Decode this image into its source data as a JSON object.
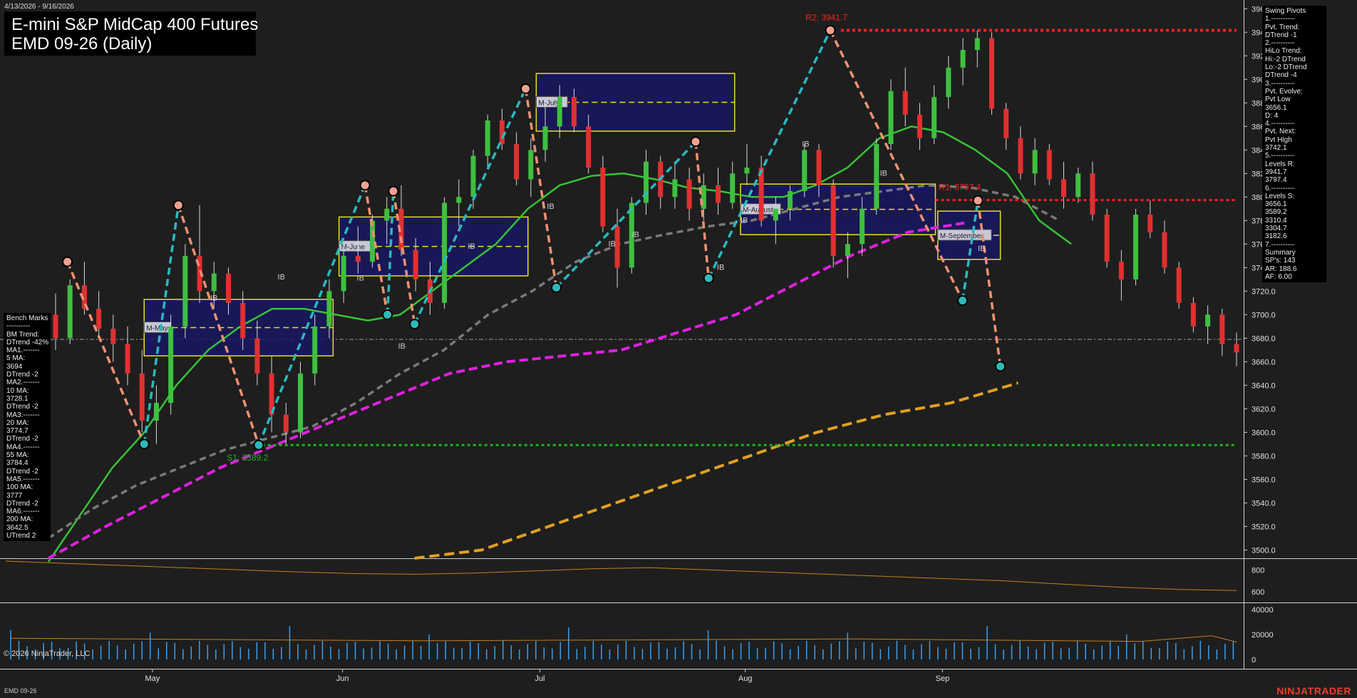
{
  "header": {
    "date_range": "4/13/2026 - 9/16/2026",
    "title_line1": "E-mini S&P MidCap 400 Futures",
    "title_line2": "EMD 09-26 (Daily)"
  },
  "swing_panel": {
    "lines": [
      "Swing Pivots",
      "1.----------",
      "Pvt. Trend:",
      "DTrend -1",
      "2.----------",
      "HiLo Trend:",
      "Hi:-2 DTrend",
      "Lo:-2 DTrend",
      "DTrend -4",
      "3.----------",
      "Pvt. Evolve:",
      "Pvt Low",
      "3656.1",
      "D: 4",
      "4.----------",
      "Pvt. Next:",
      "Pvt High",
      "3742.1",
      "5.----------",
      "Levels R:",
      "3941.7",
      "3797.4",
      "6.----------",
      "Levels S:",
      "3656.1",
      "3589.2",
      "3310.4",
      "3304.7",
      "3182.6",
      "7.----------",
      "Summary",
      "SP's: 143",
      "AR: 188.6",
      "AF: 6.00"
    ]
  },
  "bench_panel": {
    "lines": [
      "Bench Marks",
      "----------",
      "BM Trend:",
      "DTrend -42%",
      "MA1.-------",
      "5 MA:",
      "3694",
      "DTrend -2",
      "MA2.-------",
      "10 MA:",
      "3728.1",
      "DTrend -2",
      "MA3.-------",
      "20 MA:",
      "3774.7",
      "DTrend -2",
      "MA4.-------",
      "55 MA:",
      "3784.4",
      "DTrend -2",
      "MA5.-------",
      "100 MA:",
      "3777",
      "DTrend -2",
      "MA6.-------",
      "200 MA:",
      "3642.5",
      "UTrend 2"
    ]
  },
  "footer": {
    "copyright": "© 2026 NinjaTrader, LLC",
    "instrument": "EMD 09-26",
    "brand": "NINJATRADER"
  },
  "colors": {
    "background": "#1e1e1e",
    "up_candle": "#3fbf3f",
    "down_candle": "#e03030",
    "swing_up": "#2ab8c0",
    "swing_down": "#f09070",
    "ma_green": "#36c436",
    "ma_gray": "#7a7a7a",
    "ma_magenta": "#e020e0",
    "ma_orange": "#e0a020",
    "resistance": "#ff2020",
    "support": "#20b020",
    "box_fill": "#181862",
    "box_border": "#e8e020",
    "volume": "#3aa0f0"
  },
  "chart_data": {
    "type": "candlestick",
    "y_axis_ticks": [
      3500,
      3520,
      3540,
      3560,
      3580,
      3600,
      3620,
      3640,
      3660,
      3680,
      3700,
      3720,
      3740,
      3760,
      3780,
      3800,
      3820,
      3840,
      3860,
      3880,
      3900,
      3920,
      3940,
      3960
    ],
    "ylim": [
      3493,
      3965
    ],
    "x_axis_labels": [
      "May",
      "Jun",
      "Jul",
      "Aug",
      "Sep"
    ],
    "candles": [
      {
        "o": 3700,
        "h": 3718,
        "l": 3670,
        "c": 3680
      },
      {
        "o": 3680,
        "h": 3730,
        "l": 3675,
        "c": 3725
      },
      {
        "o": 3725,
        "h": 3745,
        "l": 3700,
        "c": 3705
      },
      {
        "o": 3705,
        "h": 3720,
        "l": 3680,
        "c": 3688
      },
      {
        "o": 3688,
        "h": 3700,
        "l": 3660,
        "c": 3675
      },
      {
        "o": 3675,
        "h": 3690,
        "l": 3640,
        "c": 3650
      },
      {
        "o": 3650,
        "h": 3670,
        "l": 3600,
        "c": 3610
      },
      {
        "o": 3610,
        "h": 3640,
        "l": 3590,
        "c": 3625
      },
      {
        "o": 3625,
        "h": 3700,
        "l": 3615,
        "c": 3690
      },
      {
        "o": 3690,
        "h": 3760,
        "l": 3680,
        "c": 3750
      },
      {
        "o": 3750,
        "h": 3793,
        "l": 3710,
        "c": 3720
      },
      {
        "o": 3720,
        "h": 3745,
        "l": 3705,
        "c": 3735
      },
      {
        "o": 3735,
        "h": 3740,
        "l": 3700,
        "c": 3710
      },
      {
        "o": 3710,
        "h": 3720,
        "l": 3670,
        "c": 3680
      },
      {
        "o": 3680,
        "h": 3695,
        "l": 3640,
        "c": 3650
      },
      {
        "o": 3650,
        "h": 3665,
        "l": 3600,
        "c": 3615
      },
      {
        "o": 3615,
        "h": 3625,
        "l": 3589,
        "c": 3600
      },
      {
        "o": 3600,
        "h": 3660,
        "l": 3595,
        "c": 3650
      },
      {
        "o": 3650,
        "h": 3700,
        "l": 3640,
        "c": 3690
      },
      {
        "o": 3690,
        "h": 3730,
        "l": 3680,
        "c": 3720
      },
      {
        "o": 3720,
        "h": 3760,
        "l": 3710,
        "c": 3750
      },
      {
        "o": 3750,
        "h": 3775,
        "l": 3735,
        "c": 3745
      },
      {
        "o": 3745,
        "h": 3785,
        "l": 3740,
        "c": 3780
      },
      {
        "o": 3780,
        "h": 3800,
        "l": 3760,
        "c": 3790
      },
      {
        "o": 3790,
        "h": 3810,
        "l": 3750,
        "c": 3755
      },
      {
        "o": 3755,
        "h": 3765,
        "l": 3720,
        "c": 3730
      },
      {
        "o": 3730,
        "h": 3745,
        "l": 3700,
        "c": 3710
      },
      {
        "o": 3710,
        "h": 3800,
        "l": 3705,
        "c": 3795
      },
      {
        "o": 3795,
        "h": 3815,
        "l": 3775,
        "c": 3800
      },
      {
        "o": 3800,
        "h": 3840,
        "l": 3790,
        "c": 3835
      },
      {
        "o": 3835,
        "h": 3870,
        "l": 3825,
        "c": 3865
      },
      {
        "o": 3865,
        "h": 3875,
        "l": 3840,
        "c": 3845
      },
      {
        "o": 3845,
        "h": 3855,
        "l": 3810,
        "c": 3815
      },
      {
        "o": 3815,
        "h": 3850,
        "l": 3800,
        "c": 3840
      },
      {
        "o": 3840,
        "h": 3880,
        "l": 3830,
        "c": 3860
      },
      {
        "o": 3860,
        "h": 3895,
        "l": 3850,
        "c": 3885
      },
      {
        "o": 3885,
        "h": 3892,
        "l": 3855,
        "c": 3860
      },
      {
        "o": 3860,
        "h": 3870,
        "l": 3820,
        "c": 3825
      },
      {
        "o": 3825,
        "h": 3835,
        "l": 3770,
        "c": 3775
      },
      {
        "o": 3775,
        "h": 3790,
        "l": 3723,
        "c": 3740
      },
      {
        "o": 3740,
        "h": 3800,
        "l": 3735,
        "c": 3795
      },
      {
        "o": 3795,
        "h": 3840,
        "l": 3785,
        "c": 3830
      },
      {
        "o": 3830,
        "h": 3835,
        "l": 3790,
        "c": 3800
      },
      {
        "o": 3800,
        "h": 3830,
        "l": 3790,
        "c": 3815
      },
      {
        "o": 3815,
        "h": 3825,
        "l": 3780,
        "c": 3790
      },
      {
        "o": 3790,
        "h": 3820,
        "l": 3780,
        "c": 3810
      },
      {
        "o": 3810,
        "h": 3825,
        "l": 3785,
        "c": 3795
      },
      {
        "o": 3795,
        "h": 3830,
        "l": 3790,
        "c": 3820
      },
      {
        "o": 3820,
        "h": 3845,
        "l": 3810,
        "c": 3825
      },
      {
        "o": 3825,
        "h": 3835,
        "l": 3775,
        "c": 3780
      },
      {
        "o": 3780,
        "h": 3800,
        "l": 3760,
        "c": 3790
      },
      {
        "o": 3790,
        "h": 3810,
        "l": 3780,
        "c": 3805
      },
      {
        "o": 3805,
        "h": 3845,
        "l": 3800,
        "c": 3840
      },
      {
        "o": 3840,
        "h": 3845,
        "l": 3800,
        "c": 3810
      },
      {
        "o": 3810,
        "h": 3815,
        "l": 3740,
        "c": 3750
      },
      {
        "o": 3750,
        "h": 3770,
        "l": 3731,
        "c": 3760
      },
      {
        "o": 3760,
        "h": 3800,
        "l": 3750,
        "c": 3790
      },
      {
        "o": 3790,
        "h": 3850,
        "l": 3785,
        "c": 3845
      },
      {
        "o": 3845,
        "h": 3900,
        "l": 3840,
        "c": 3890
      },
      {
        "o": 3890,
        "h": 3910,
        "l": 3860,
        "c": 3870
      },
      {
        "o": 3870,
        "h": 3880,
        "l": 3840,
        "c": 3850
      },
      {
        "o": 3850,
        "h": 3895,
        "l": 3845,
        "c": 3885
      },
      {
        "o": 3885,
        "h": 3920,
        "l": 3875,
        "c": 3910
      },
      {
        "o": 3910,
        "h": 3935,
        "l": 3895,
        "c": 3925
      },
      {
        "o": 3925,
        "h": 3941.7,
        "l": 3910,
        "c": 3935
      },
      {
        "o": 3935,
        "h": 3940,
        "l": 3870,
        "c": 3875
      },
      {
        "o": 3875,
        "h": 3880,
        "l": 3840,
        "c": 3850
      },
      {
        "o": 3850,
        "h": 3860,
        "l": 3815,
        "c": 3820
      },
      {
        "o": 3820,
        "h": 3850,
        "l": 3810,
        "c": 3840
      },
      {
        "o": 3840,
        "h": 3845,
        "l": 3810,
        "c": 3815
      },
      {
        "o": 3815,
        "h": 3830,
        "l": 3790,
        "c": 3800
      },
      {
        "o": 3800,
        "h": 3825,
        "l": 3795,
        "c": 3820
      },
      {
        "o": 3820,
        "h": 3830,
        "l": 3780,
        "c": 3785
      },
      {
        "o": 3785,
        "h": 3790,
        "l": 3740,
        "c": 3745
      },
      {
        "o": 3745,
        "h": 3755,
        "l": 3712,
        "c": 3730
      },
      {
        "o": 3730,
        "h": 3790,
        "l": 3725,
        "c": 3785
      },
      {
        "o": 3785,
        "h": 3797,
        "l": 3765,
        "c": 3770
      },
      {
        "o": 3770,
        "h": 3780,
        "l": 3735,
        "c": 3740
      },
      {
        "o": 3740,
        "h": 3745,
        "l": 3705,
        "c": 3710
      },
      {
        "o": 3710,
        "h": 3715,
        "l": 3685,
        "c": 3690
      },
      {
        "o": 3690,
        "h": 3708,
        "l": 3675,
        "c": 3700
      },
      {
        "o": 3700,
        "h": 3705,
        "l": 3665,
        "c": 3675
      },
      {
        "o": 3675,
        "h": 3685,
        "l": 3656.1,
        "c": 3668
      }
    ],
    "moving_averages": [
      {
        "name": "MA green",
        "values": [
          3490,
          3530,
          3570,
          3600,
          3640,
          3670,
          3690,
          3705,
          3705,
          3700,
          3695,
          3700,
          3720,
          3740,
          3760,
          3790,
          3810,
          3818,
          3820,
          3815,
          3808,
          3805,
          3800,
          3800,
          3810,
          3825,
          3850,
          3860,
          3855,
          3840,
          3820,
          3780,
          3760
        ]
      },
      {
        "name": "MA gray",
        "values": [
          3510,
          3535,
          3555,
          3570,
          3585,
          3595,
          3605,
          3625,
          3650,
          3670,
          3700,
          3720,
          3745,
          3760,
          3768,
          3775,
          3780,
          3790,
          3800,
          3805,
          3810,
          3808,
          3800,
          3780
        ]
      },
      {
        "name": "MA magenta",
        "values": [
          3493,
          3520,
          3545,
          3570,
          3590,
          3610,
          3630,
          3650,
          3660,
          3665,
          3670,
          3685,
          3700,
          3725,
          3750,
          3770,
          3778
        ]
      },
      {
        "name": "MA orange",
        "values": [
          3493,
          3500,
          3520,
          3540,
          3560,
          3580,
          3600,
          3615,
          3625,
          3642
        ]
      }
    ],
    "swing_pivots": [
      {
        "type": "high",
        "y": 3745
      },
      {
        "type": "low",
        "y": 3590
      },
      {
        "type": "high",
        "y": 3793
      },
      {
        "type": "low",
        "y": 3589.2
      },
      {
        "type": "high",
        "y": 3810
      },
      {
        "type": "low",
        "y": 3700
      },
      {
        "type": "high",
        "y": 3805
      },
      {
        "type": "low",
        "y": 3692
      },
      {
        "type": "high",
        "y": 3892
      },
      {
        "type": "low",
        "y": 3723
      },
      {
        "type": "high",
        "y": 3847
      },
      {
        "type": "low",
        "y": 3731
      },
      {
        "type": "high",
        "y": 3941.7
      },
      {
        "type": "low",
        "y": 3712
      },
      {
        "type": "high",
        "y": 3797
      },
      {
        "type": "low",
        "y": 3656.1
      }
    ],
    "levels": [
      {
        "label": "R2: 3941.7",
        "value": 3941.7,
        "kind": "resistance"
      },
      {
        "label": "R1: 3797.4",
        "value": 3797.4,
        "kind": "resistance"
      },
      {
        "label": "S1: 3589.2",
        "value": 3589.2,
        "kind": "support"
      }
    ],
    "reference_lines": [
      3679
    ],
    "monthly_boxes": [
      {
        "label": "M-May",
        "low": 3665,
        "high": 3713
      },
      {
        "label": "M-June",
        "low": 3733,
        "high": 3783
      },
      {
        "label": "M-July",
        "low": 3856,
        "high": 3905
      },
      {
        "label": "M-August",
        "low": 3768,
        "high": 3811
      },
      {
        "label": "M-September",
        "low": 3747,
        "high": 3788
      }
    ],
    "ib_labels": [
      "IB",
      "IB",
      "IB",
      "IB",
      "IB",
      "IB",
      "IB",
      "IB",
      "IB",
      "IB",
      "IB",
      "IB",
      "IB"
    ],
    "lower_indicator": {
      "ticks": [
        600,
        800
      ],
      "values": [
        880,
        860,
        840,
        820,
        800,
        780,
        765,
        760,
        770,
        790,
        810,
        820,
        800,
        780,
        760,
        740,
        720,
        700,
        670,
        640,
        620,
        610
      ]
    },
    "volume": {
      "ticks": [
        0,
        20000,
        40000
      ]
    }
  }
}
